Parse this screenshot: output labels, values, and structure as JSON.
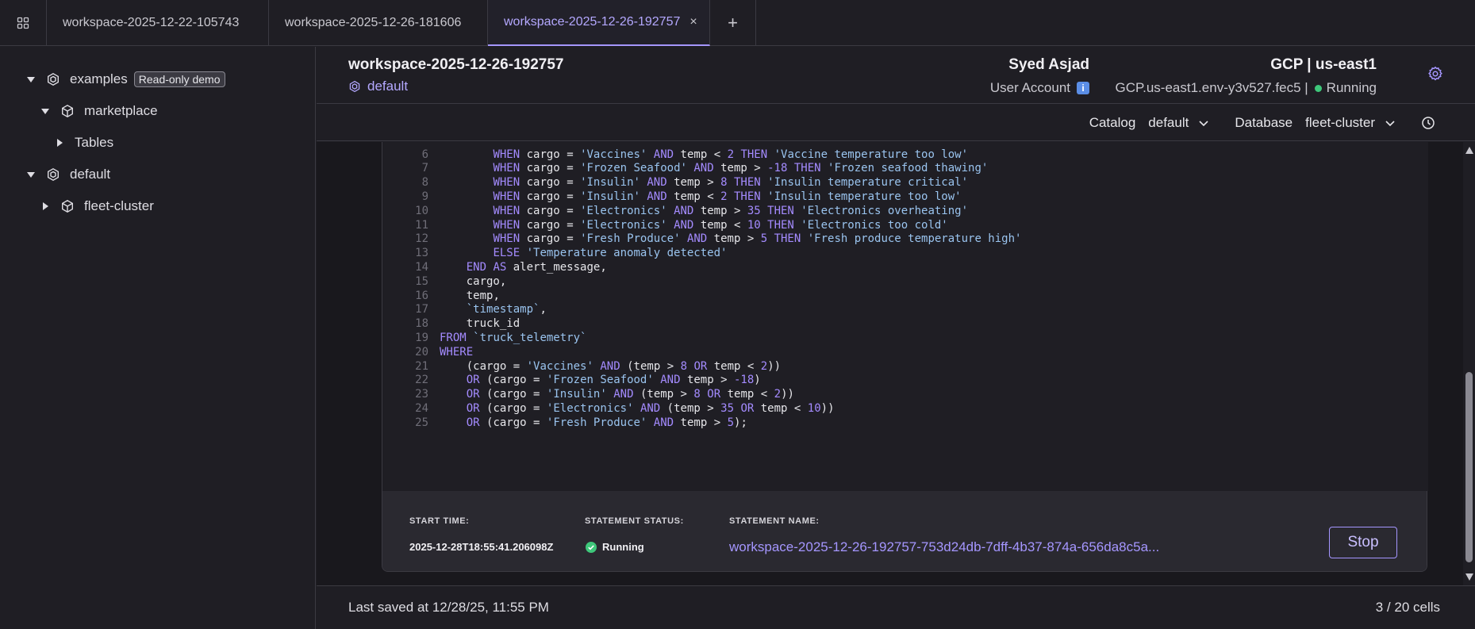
{
  "tabs": [
    {
      "label": "workspace-2025-12-22-105743",
      "active": false
    },
    {
      "label": "workspace-2025-12-26-181606",
      "active": false
    },
    {
      "label": "workspace-2025-12-26-192757",
      "active": true
    }
  ],
  "tab_close_glyph": "×",
  "tab_add_glyph": "+",
  "sidebar": {
    "items": [
      {
        "label": "examples",
        "badge": "Read-only demo",
        "icon": "catalog-icon",
        "expanded": true
      },
      {
        "label": "marketplace",
        "icon": "database-icon",
        "expanded": true
      },
      {
        "label": "Tables",
        "expanded": false
      },
      {
        "label": "default",
        "icon": "catalog-icon",
        "expanded": true
      },
      {
        "label": "fleet-cluster",
        "icon": "database-icon",
        "expanded": false
      }
    ]
  },
  "header": {
    "workspace_name": "workspace-2025-12-26-192757",
    "catalog_name": "default",
    "user_name": "Syed Asjad",
    "account_type": "User Account",
    "account_info_glyph": "i",
    "env_title": "GCP | us-east1",
    "env_id": "GCP.us-east1.env-y3v527.fec5 |",
    "env_status": "Running"
  },
  "toolbar": {
    "catalog_label": "Catalog",
    "catalog_value": "default",
    "database_label": "Database",
    "database_value": "fleet-cluster"
  },
  "code": {
    "lines": [
      {
        "n": "6",
        "text": "        WHEN cargo = 'Vaccines' AND temp < 2 THEN 'Vaccine temperature too low'"
      },
      {
        "n": "7",
        "text": "        WHEN cargo = 'Frozen Seafood' AND temp > -18 THEN 'Frozen seafood thawing'"
      },
      {
        "n": "8",
        "text": "        WHEN cargo = 'Insulin' AND temp > 8 THEN 'Insulin temperature critical'"
      },
      {
        "n": "9",
        "text": "        WHEN cargo = 'Insulin' AND temp < 2 THEN 'Insulin temperature too low'"
      },
      {
        "n": "10",
        "text": "        WHEN cargo = 'Electronics' AND temp > 35 THEN 'Electronics overheating'"
      },
      {
        "n": "11",
        "text": "        WHEN cargo = 'Electronics' AND temp < 10 THEN 'Electronics too cold'"
      },
      {
        "n": "12",
        "text": "        WHEN cargo = 'Fresh Produce' AND temp > 5 THEN 'Fresh produce temperature high'"
      },
      {
        "n": "13",
        "text": "        ELSE 'Temperature anomaly detected'"
      },
      {
        "n": "14",
        "text": "    END AS alert_message,"
      },
      {
        "n": "15",
        "text": "    cargo,"
      },
      {
        "n": "16",
        "text": "    temp,"
      },
      {
        "n": "17",
        "text": "    `timestamp`,"
      },
      {
        "n": "18",
        "text": "    truck_id"
      },
      {
        "n": "19",
        "text": "FROM `truck_telemetry`"
      },
      {
        "n": "20",
        "text": "WHERE"
      },
      {
        "n": "21",
        "text": "    (cargo = 'Vaccines' AND (temp > 8 OR temp < 2))"
      },
      {
        "n": "22",
        "text": "    OR (cargo = 'Frozen Seafood' AND temp > -18)"
      },
      {
        "n": "23",
        "text": "    OR (cargo = 'Insulin' AND (temp > 8 OR temp < 2))"
      },
      {
        "n": "24",
        "text": "    OR (cargo = 'Electronics' AND (temp > 35 OR temp < 10))"
      },
      {
        "n": "25",
        "text": "    OR (cargo = 'Fresh Produce' AND temp > 5);"
      }
    ]
  },
  "statement": {
    "start_time_label": "START TIME:",
    "start_time": "2025-12-28T18:55:41.206098Z",
    "status_label": "STATEMENT STATUS:",
    "status": "Running",
    "name_label": "STATEMENT NAME:",
    "name": "workspace-2025-12-26-192757-753d24db-7dff-4b37-874a-656da8c5a...",
    "stop_label": "Stop"
  },
  "footer": {
    "last_saved": "Last saved at 12/28/25, 11:55 PM",
    "cell_count": "3 / 20 cells"
  },
  "colors": {
    "accent": "#a596ff",
    "keyword": "#a48bff",
    "string": "#9ac4ef",
    "running": "#3ec77a",
    "background": "#1f1e24"
  }
}
